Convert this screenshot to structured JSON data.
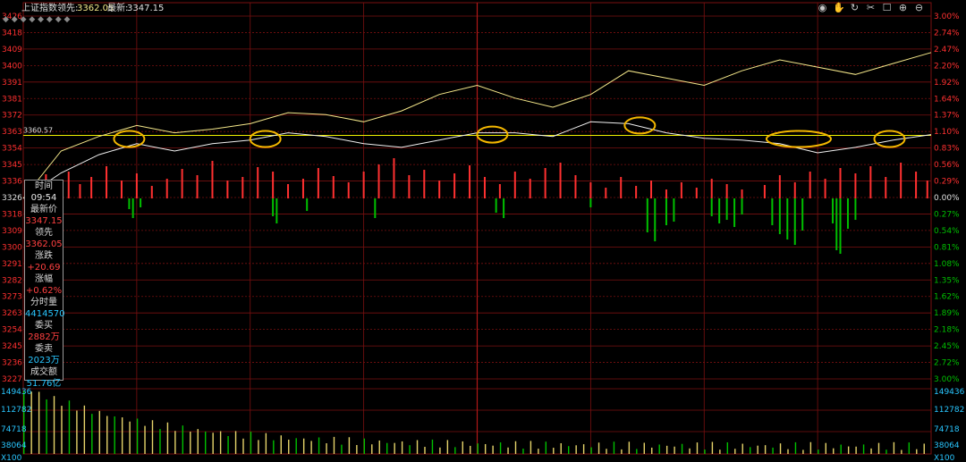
{
  "header": {
    "index_name": "上证指数",
    "leader_label": "领先:",
    "leader_value": "3362.05",
    "latest_label": "最新:",
    "latest_value": "3347.15"
  },
  "toolbar_icons": [
    "eye-icon",
    "hand-icon",
    "refresh-icon",
    "scissors-icon",
    "square-icon",
    "plus-icon",
    "minus-icon"
  ],
  "reference_line_label": "3360.57",
  "info_panel": {
    "time_label": "时间",
    "time_value": "09:54",
    "latest_label": "最新价",
    "latest_value": "3347.15",
    "leader_label": "领先",
    "leader_value": "3362.05",
    "change_label": "涨跌",
    "change_value": "+20.69",
    "pct_label": "涨幅",
    "pct_value": "+0.62%",
    "vol_label": "分时量",
    "vol_value": "4414570",
    "bid_label": "委买",
    "bid_value": "2882万",
    "ask_label": "委卖",
    "ask_value": "2023万",
    "amount_label": "成交额",
    "amount_value": "51.76亿"
  },
  "colors": {
    "background": "#000000",
    "grid": "#7a1010",
    "up": "#ff3030",
    "down": "#00c000",
    "price_line": "#f0f0f0",
    "leader_line": "#f5e88a",
    "reference": "#f0f000",
    "highlight": "#f5b800",
    "axis_text_red": "#ff3030",
    "axis_text_green": "#00c000",
    "volume_axis_text": "#29c6ff"
  },
  "chart_data": {
    "type": "line",
    "price_axis": {
      "ticks": [
        "3426",
        "3418",
        "3409",
        "3400",
        "3391",
        "3381",
        "3372",
        "3363",
        "3354",
        "3345",
        "3336",
        "3326",
        "3318",
        "3309",
        "3300",
        "3291",
        "3282",
        "3273",
        "3263",
        "3254",
        "3245",
        "3236",
        "3227"
      ],
      "ylim": [
        3227,
        3426
      ],
      "base": 3326
    },
    "pct_axis": {
      "ticks": [
        "3.00%",
        "2.74%",
        "2.47%",
        "2.20%",
        "1.92%",
        "1.64%",
        "1.37%",
        "1.10%",
        "0.83%",
        "0.56%",
        "0.29%",
        "0.00%",
        "0.27%",
        "0.54%",
        "0.81%",
        "1.08%",
        "1.35%",
        "1.62%",
        "1.89%",
        "2.18%",
        "2.45%",
        "2.72%",
        "3.00%"
      ]
    },
    "volume_axis": {
      "ticks": [
        "149436",
        "112782",
        "74718",
        "38064"
      ],
      "unit": "X100"
    },
    "reference_value": 3360.57,
    "x": [
      0,
      10,
      20,
      30,
      40,
      50,
      60,
      70,
      80,
      90,
      100,
      110,
      120,
      130,
      140,
      150,
      160,
      170,
      180,
      190,
      200,
      210,
      220,
      230,
      240
    ],
    "series": [
      {
        "values": [
          3326,
          3352,
          3360,
          3366,
          3362,
          3364,
          3367,
          3373,
          3372,
          3368,
          3374,
          3383,
          3388,
          3381,
          3376,
          3383,
          3396,
          3392,
          3388,
          3396,
          3402,
          3398,
          3394,
          3400,
          3406
        ]
      },
      {
        "values": [
          3326,
          3340,
          3350,
          3356,
          3352,
          3356,
          3358,
          3362,
          3360,
          3356,
          3354,
          3358,
          3362,
          3362,
          3360,
          3368,
          3367,
          3362,
          3359,
          3358,
          3356,
          3351,
          3354,
          3358,
          3361
        ]
      }
    ],
    "volume_bars_above": [
      {
        "x": 3,
        "v": 14
      },
      {
        "x": 6,
        "v": 27
      },
      {
        "x": 9,
        "v": 18
      },
      {
        "x": 12,
        "v": 30
      },
      {
        "x": 15,
        "v": 16
      },
      {
        "x": 18,
        "v": 24
      },
      {
        "x": 22,
        "v": 36
      },
      {
        "x": 26,
        "v": 20
      },
      {
        "x": 30,
        "v": 28
      },
      {
        "x": 34,
        "v": 14
      },
      {
        "x": 38,
        "v": 22
      },
      {
        "x": 42,
        "v": 33
      },
      {
        "x": 46,
        "v": 26
      },
      {
        "x": 50,
        "v": 42
      },
      {
        "x": 54,
        "v": 20
      },
      {
        "x": 58,
        "v": 24
      },
      {
        "x": 62,
        "v": 35
      },
      {
        "x": 66,
        "v": 30
      },
      {
        "x": 70,
        "v": 16
      },
      {
        "x": 74,
        "v": 22
      },
      {
        "x": 78,
        "v": 34
      },
      {
        "x": 82,
        "v": 25
      },
      {
        "x": 86,
        "v": 18
      },
      {
        "x": 90,
        "v": 30
      },
      {
        "x": 94,
        "v": 38
      },
      {
        "x": 98,
        "v": 45
      },
      {
        "x": 102,
        "v": 26
      },
      {
        "x": 106,
        "v": 32
      },
      {
        "x": 110,
        "v": 20
      },
      {
        "x": 114,
        "v": 28
      },
      {
        "x": 118,
        "v": 37
      },
      {
        "x": 122,
        "v": 24
      },
      {
        "x": 126,
        "v": 16
      },
      {
        "x": 130,
        "v": 30
      },
      {
        "x": 134,
        "v": 22
      },
      {
        "x": 138,
        "v": 34
      },
      {
        "x": 142,
        "v": 40
      },
      {
        "x": 146,
        "v": 26
      },
      {
        "x": 150,
        "v": 18
      },
      {
        "x": 154,
        "v": 12
      },
      {
        "x": 158,
        "v": 24
      },
      {
        "x": 162,
        "v": 14
      },
      {
        "x": 166,
        "v": 20
      },
      {
        "x": 170,
        "v": 10
      },
      {
        "x": 174,
        "v": 18
      },
      {
        "x": 178,
        "v": 12
      },
      {
        "x": 182,
        "v": 22
      },
      {
        "x": 186,
        "v": 16
      },
      {
        "x": 190,
        "v": 10
      },
      {
        "x": 196,
        "v": 15
      },
      {
        "x": 200,
        "v": 26
      },
      {
        "x": 204,
        "v": 18
      },
      {
        "x": 208,
        "v": 30
      },
      {
        "x": 212,
        "v": 22
      },
      {
        "x": 216,
        "v": 34
      },
      {
        "x": 220,
        "v": 28
      },
      {
        "x": 224,
        "v": 36
      },
      {
        "x": 228,
        "v": 24
      },
      {
        "x": 232,
        "v": 40
      },
      {
        "x": 236,
        "v": 30
      },
      {
        "x": 239,
        "v": 20
      }
    ],
    "volume_bars_below": [
      {
        "x": 28,
        "v": 12
      },
      {
        "x": 29,
        "v": 22
      },
      {
        "x": 31,
        "v": 10
      },
      {
        "x": 66,
        "v": 20
      },
      {
        "x": 67,
        "v": 28
      },
      {
        "x": 75,
        "v": 14
      },
      {
        "x": 93,
        "v": 22
      },
      {
        "x": 125,
        "v": 16
      },
      {
        "x": 127,
        "v": 22
      },
      {
        "x": 150,
        "v": 10
      },
      {
        "x": 165,
        "v": 38
      },
      {
        "x": 167,
        "v": 48
      },
      {
        "x": 170,
        "v": 30
      },
      {
        "x": 172,
        "v": 26
      },
      {
        "x": 182,
        "v": 20
      },
      {
        "x": 184,
        "v": 28
      },
      {
        "x": 186,
        "v": 24
      },
      {
        "x": 188,
        "v": 32
      },
      {
        "x": 190,
        "v": 18
      },
      {
        "x": 198,
        "v": 30
      },
      {
        "x": 200,
        "v": 40
      },
      {
        "x": 202,
        "v": 46
      },
      {
        "x": 204,
        "v": 52
      },
      {
        "x": 206,
        "v": 36
      },
      {
        "x": 214,
        "v": 28
      },
      {
        "x": 215,
        "v": 58
      },
      {
        "x": 216,
        "v": 62
      },
      {
        "x": 218,
        "v": 34
      },
      {
        "x": 220,
        "v": 24
      }
    ],
    "bottom_volume": {
      "x_max": 240,
      "bars": 240
    },
    "highlight_x": [
      28,
      64,
      124,
      163,
      205,
      229
    ]
  }
}
